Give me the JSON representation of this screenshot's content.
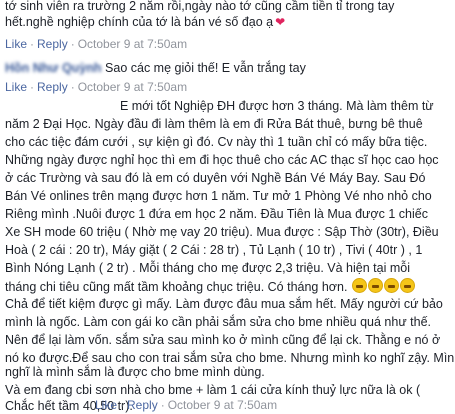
{
  "comment1": {
    "text_line1": "tớ sinh viên ra trường 2 năm rồi,ngày nào tớ cũng cầm tiền tỉ trong tay",
    "text_line2": "hết.nghề nghiệp chính của tớ là bán vé số đạo ạ",
    "heart_icon": "heart-icon",
    "like_label": "Like",
    "reply_label": "Reply",
    "timestamp": "October 9 at 7:50am"
  },
  "comment2": {
    "author_blurred": "Hồn Như Quỳnh",
    "text": "Sao các mẹ giỏi thế! E vẫn trắng tay",
    "like_label": "Like",
    "reply_label": "Reply",
    "timestamp": "October 9 at 7:50am"
  },
  "comment3": {
    "lines": [
      "E mới tốt Nghiệp ĐH được hơn 3 tháng. Mà làm thêm từ",
      "năm 2 Đại Học. Ngày đầu đi làm thêm là em đi Rửa Bát thuê, bưng bê thuê",
      "cho các tiệc đám cưới , sự kiện gì đó. Cv này thì 1 tuần chỉ có mấy bữa tiệc.",
      "Những ngày được nghỉ học thì em đi học thuê cho các AC thạc sĩ học cao học",
      "ở các Trường và sau đó là em có duyên với Nghề Bán Vé Máy Bay. Sau Đó",
      "Bán Vé onlines trên mạng được hơn 1 năm. Tư mở 1 Phòng Vé nho nhỏ cho",
      "Riêng mình .Nuôi được 1 đứa em học 2 năm. Đầu Tiên là Mua được 1 chiếc",
      "Xe SH mode 60 triệu ( Nhờ mẹ vay 20 triệu). Mua được : Sập Thờ (30tr), Điều",
      "Hoà ( 2 cái : 20 tr), Máy giặt ( 2 Cái : 28 tr) , Tủ Lạnh ( 10 tr) , Tivi ( 40tr ) , 1",
      "Bình Nóng Lạnh ( 2 tr) . Mỗi tháng cho mẹ được 2,3 triệu. Và hiện tại mỗi",
      "tháng chi tiêu cũng mất tầm khoảng chục triệu. Có tháng hơn.",
      "Chả để tiết kiệm được gì mấy. Làm được đâu mua sắm hết. Mấy người cứ bảo",
      "mình là ngốc. Làm con gái ko cần phải sắm sửa cho bme nhiều quá như thế.",
      "Nên để lại làm vốn. sắm sửa sau mình ko ở mình cũng để lại ck. Thằng e nó ở",
      "nó ko được.Để sau cho con trai sắm sửa cho bme. Nhưng mình ko nghĩ zậy. Mình",
      "nghĩ là mình sắm là được cho bme mình dùng.",
      "Và em đang cbi sơn nhà cho bme + làm 1 cái cửa kính thuỷ lực nữa là ok (",
      "Chắc hết tầm 40,50 tr)."
    ],
    "emoji_icon": "crying-face-icon",
    "emoji_count": 4,
    "like_label": "Like",
    "reply_label": "Reply",
    "timestamp": "October 9 at 7:50am"
  }
}
